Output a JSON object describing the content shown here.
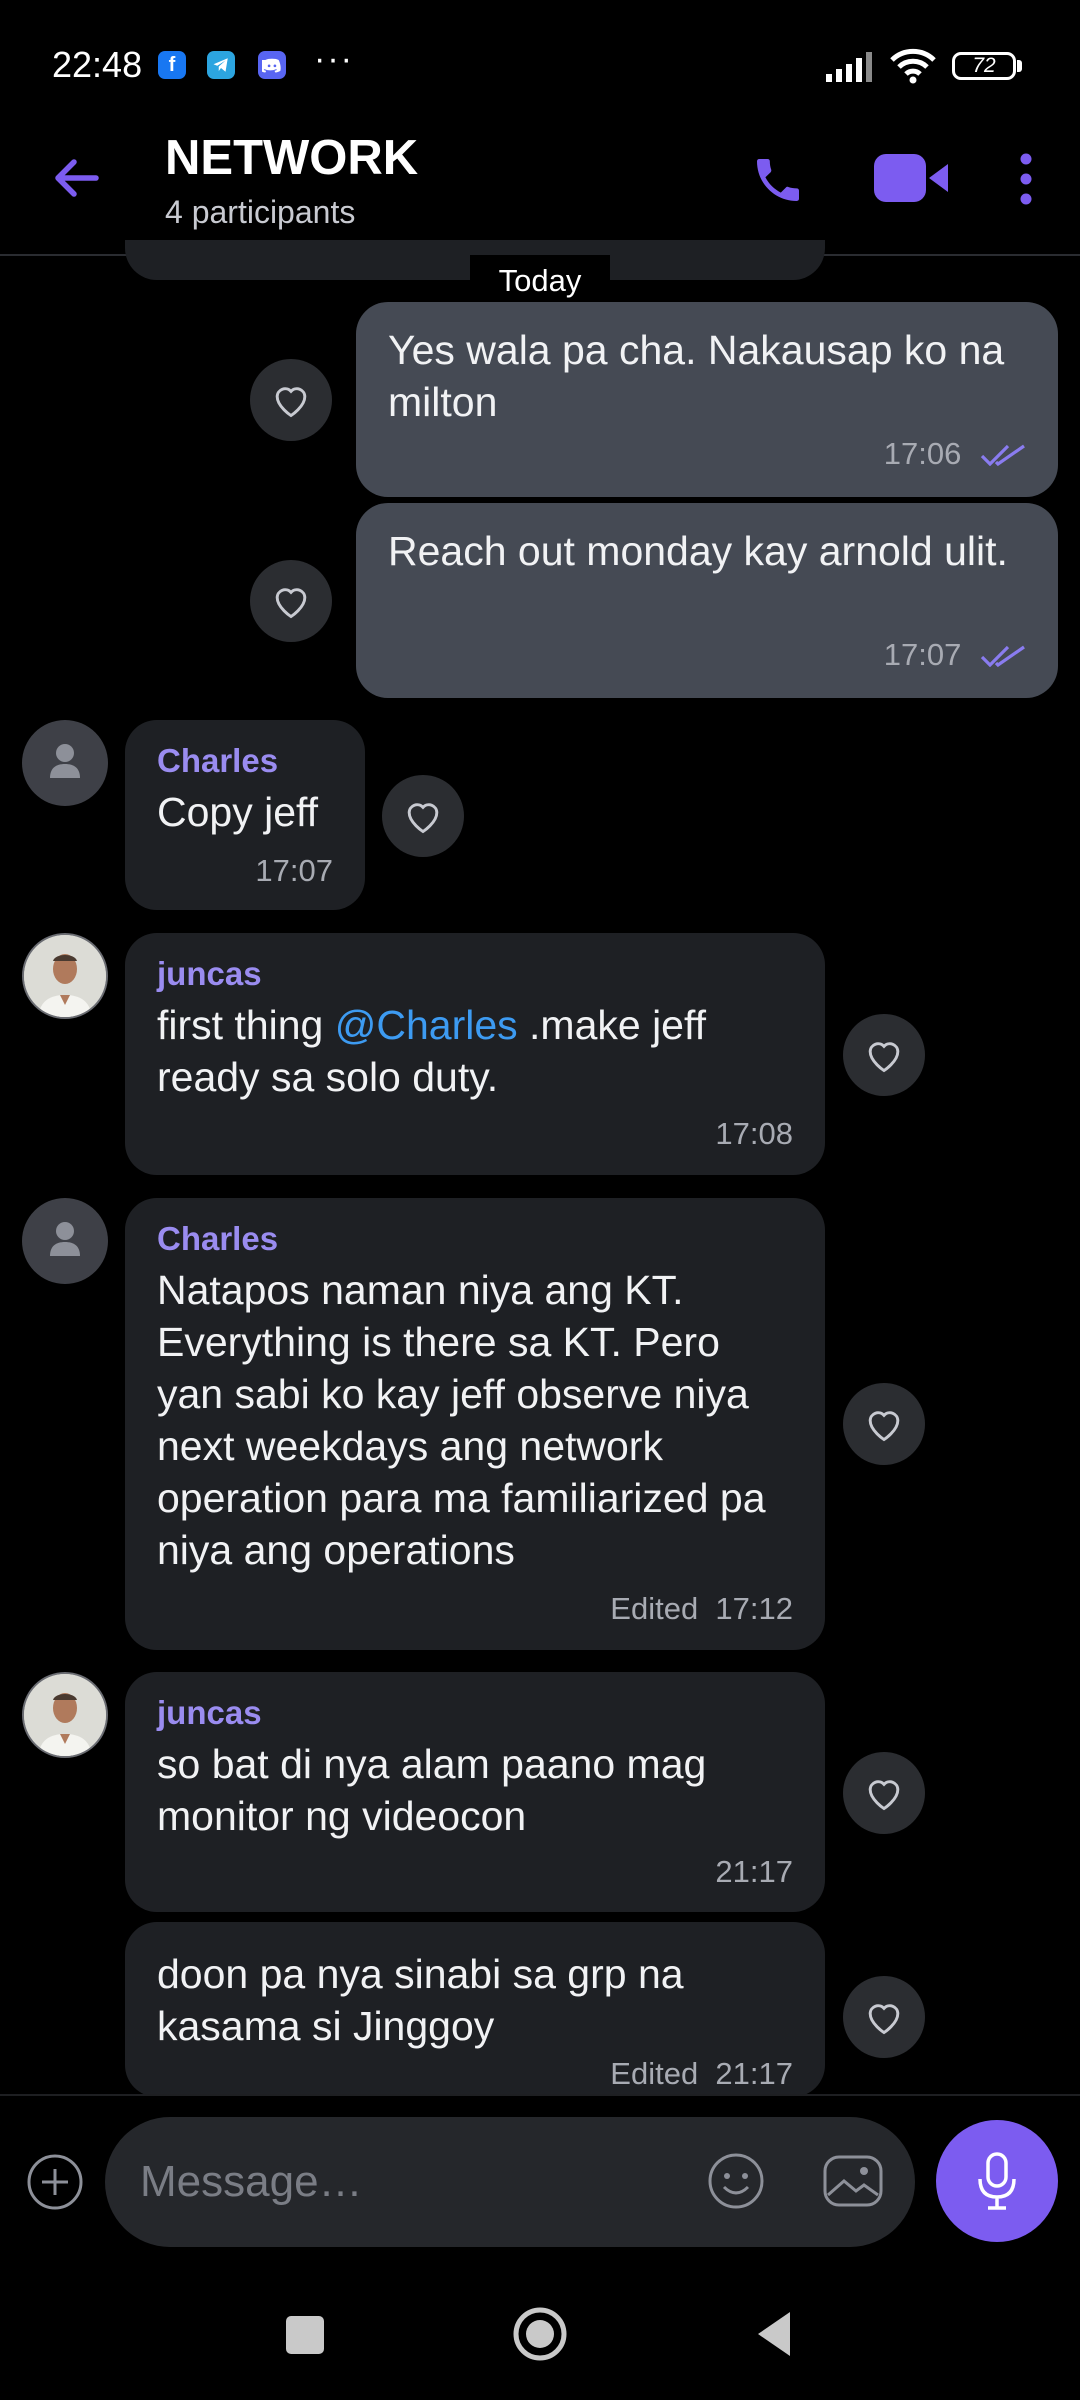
{
  "status_bar": {
    "time": "22:48",
    "notification_icons": [
      "facebook-icon",
      "telegram-icon",
      "discord-icon"
    ],
    "more": "···",
    "battery": "72"
  },
  "header": {
    "title": "NETWORK",
    "subtitle": "4 participants",
    "accent": "#7c5cf0"
  },
  "date_divider": "Today",
  "messages": [
    {
      "direction": "out",
      "text": "Yes wala pa cha. Nakausap ko na milton",
      "time": "17:06",
      "status": "read"
    },
    {
      "direction": "out",
      "text": "Reach out monday kay arnold ulit.",
      "time": "17:07",
      "status": "read"
    },
    {
      "direction": "in",
      "sender": "Charles",
      "text": "Copy jeff",
      "time": "17:07"
    },
    {
      "direction": "in",
      "sender": "juncas",
      "text_before": "first thing ",
      "mention": "@Charles",
      "text_after": " .make jeff ready sa solo duty.",
      "time": "17:08"
    },
    {
      "direction": "in",
      "sender": "Charles",
      "text": "Natapos naman niya ang KT. Everything is there sa KT. Pero yan sabi ko kay jeff observe niya next weekdays ang network operation para ma familiarized pa niya ang operations",
      "edited": "Edited",
      "time": "17:12"
    },
    {
      "direction": "in",
      "sender": "juncas",
      "text": "so bat di nya alam paano mag monitor ng videocon",
      "time": "21:17"
    },
    {
      "direction": "in",
      "text": "doon pa nya sinabi sa grp na kasama si Jinggoy",
      "edited": "Edited",
      "time": "21:17"
    }
  ],
  "composer": {
    "placeholder": "Message…"
  },
  "colors": {
    "sender_name": "#9a8cf0",
    "mention": "#3d9bf2",
    "outgoing_bubble": "#454a54",
    "incoming_bubble": "#1e2024"
  }
}
